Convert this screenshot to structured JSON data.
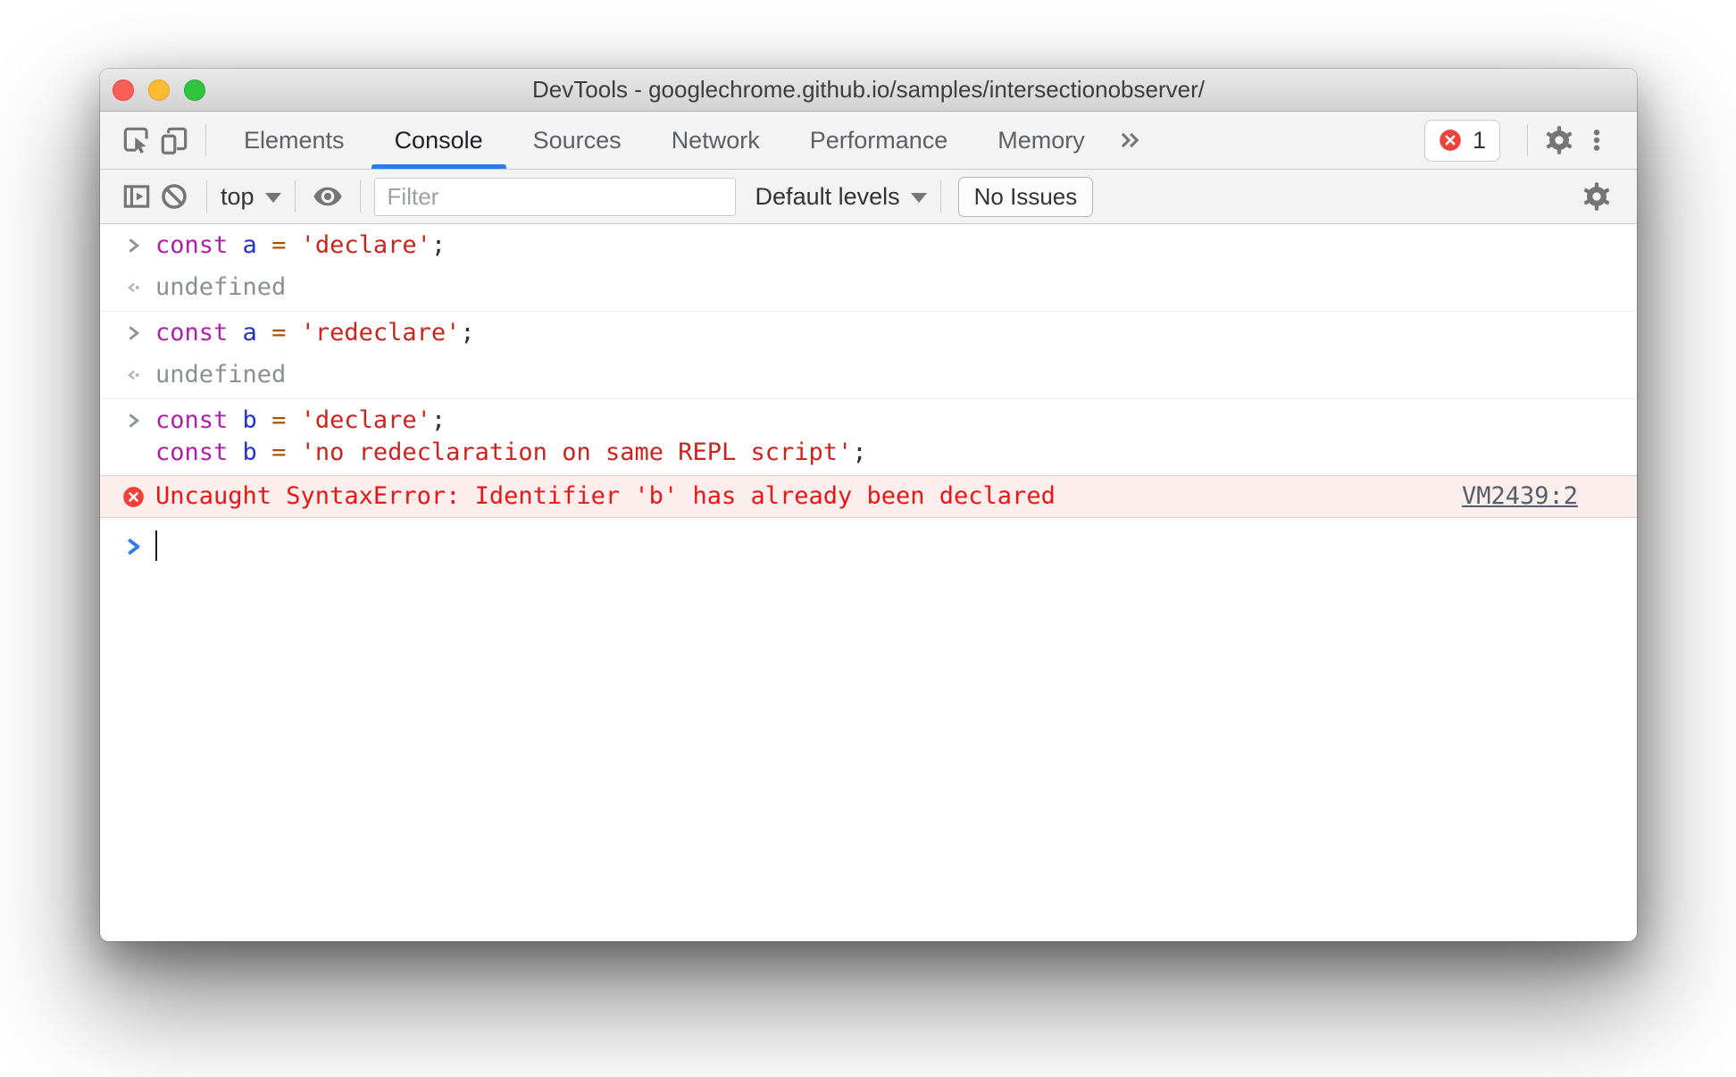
{
  "window_title": "DevTools - googlechrome.github.io/samples/intersectionobserver/",
  "tabs": {
    "items": [
      "Elements",
      "Console",
      "Sources",
      "Network",
      "Performance",
      "Memory"
    ],
    "active": "Console",
    "error_badge_count": "1"
  },
  "toolbar": {
    "context_selector": "top",
    "filter_placeholder": "Filter",
    "levels_selector": "Default levels",
    "issues_button": "No Issues"
  },
  "icons": {
    "inspect": "inspect-cursor-icon",
    "device": "device-toolbar-icon",
    "overflow": "chevron-double-right-icon",
    "settings": "gear-icon",
    "menu": "three-dot-menu-icon",
    "sidebar": "show-console-sidebar-icon",
    "clear": "circle-slash-icon",
    "live_expression": "eye-icon",
    "error": "error-circle-x-icon"
  },
  "console": {
    "entries": [
      {
        "kind": "input",
        "tokens": [
          {
            "type": "keyword",
            "text": "const "
          },
          {
            "type": "variable",
            "text": "a"
          },
          {
            "type": "operator",
            "text": " = "
          },
          {
            "type": "string",
            "text": "'declare'"
          },
          {
            "type": "plain",
            "text": ";"
          }
        ]
      },
      {
        "kind": "result",
        "text": "undefined"
      },
      {
        "kind": "input",
        "tokens": [
          {
            "type": "keyword",
            "text": "const "
          },
          {
            "type": "variable",
            "text": "a"
          },
          {
            "type": "operator",
            "text": " = "
          },
          {
            "type": "string",
            "text": "'redeclare'"
          },
          {
            "type": "plain",
            "text": ";"
          }
        ]
      },
      {
        "kind": "result",
        "text": "undefined"
      },
      {
        "kind": "input",
        "lines": [
          {
            "tokens": [
              {
                "type": "keyword",
                "text": "const "
              },
              {
                "type": "variable",
                "text": "b"
              },
              {
                "type": "operator",
                "text": " = "
              },
              {
                "type": "string",
                "text": "'declare'"
              },
              {
                "type": "plain",
                "text": ";"
              }
            ]
          },
          {
            "tokens": [
              {
                "type": "keyword",
                "text": "const "
              },
              {
                "type": "variable",
                "text": "b"
              },
              {
                "type": "operator",
                "text": " = "
              },
              {
                "type": "string",
                "text": "'no redeclaration on same REPL script'"
              },
              {
                "type": "plain",
                "text": ";"
              }
            ]
          }
        ]
      },
      {
        "kind": "error",
        "text": "Uncaught SyntaxError: Identifier 'b' has already been declared",
        "source_link": "VM2439:2"
      },
      {
        "kind": "prompt"
      }
    ]
  },
  "colors": {
    "accent_blue": "#2d7bf0",
    "toolbar_bg": "#f3f3f3",
    "error_text": "#e81616",
    "error_bg": "#fdeeee",
    "error_border": "#f5caca",
    "badge_red": "#ed4239",
    "prompt_blue": "#2f7cf6",
    "syntax": {
      "keyword": "#b021ab",
      "variable": "#2633c8",
      "operator": "#a85300",
      "string": "#cc241c",
      "plain": "#303030",
      "result_muted": "#8b8f94"
    }
  }
}
